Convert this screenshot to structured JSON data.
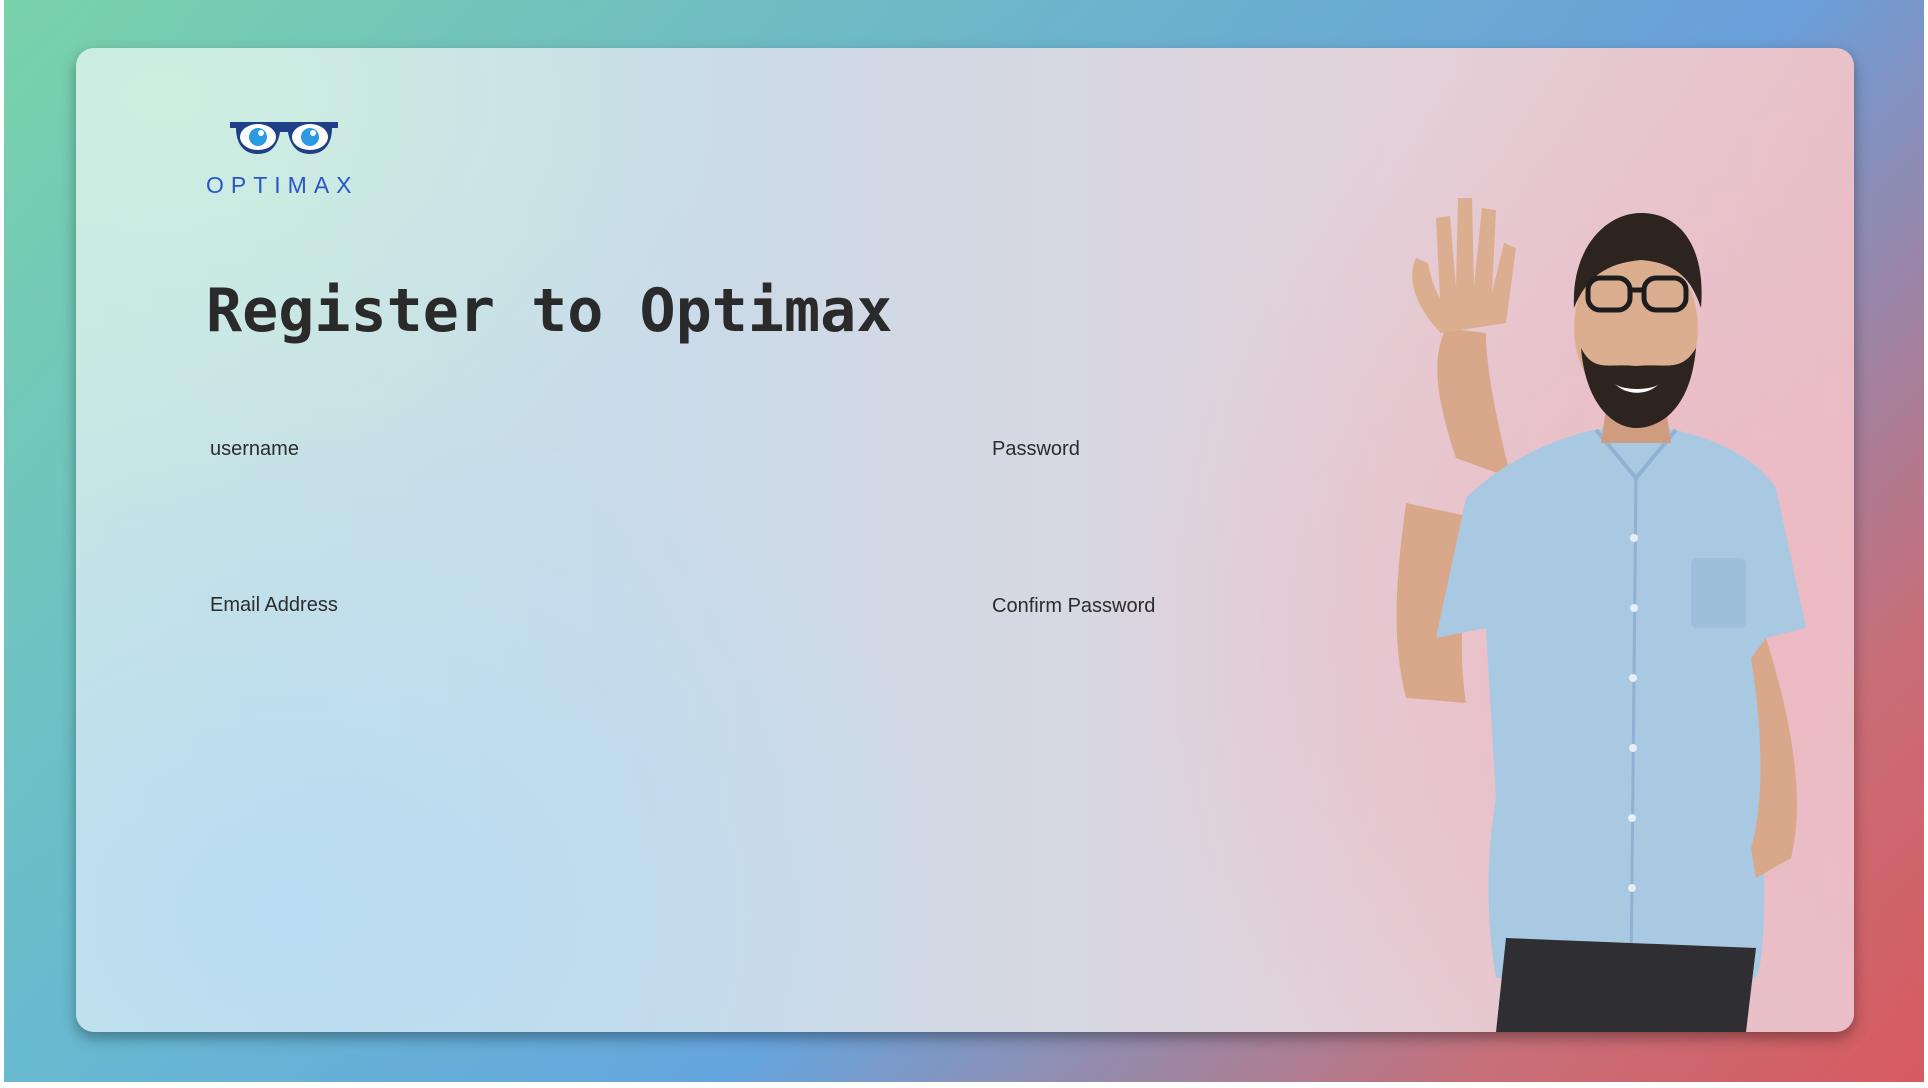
{
  "brand": {
    "name": "OPTIMAX",
    "logo_icon": "glasses-icon",
    "color": "#2b55c7"
  },
  "page": {
    "title": "Register to Optimax"
  },
  "form": {
    "username": {
      "label": "username",
      "value": ""
    },
    "password": {
      "label": "Password",
      "value": ""
    },
    "email": {
      "label": "Email Address",
      "value": ""
    },
    "confirm_password": {
      "label": "Confirm Password",
      "value": ""
    }
  },
  "hero": {
    "image": "waving-man-illustration"
  },
  "colors": {
    "gradient_start": "#7fd0b3",
    "gradient_end": "#d46268",
    "title_text": "#2a2a2a"
  }
}
